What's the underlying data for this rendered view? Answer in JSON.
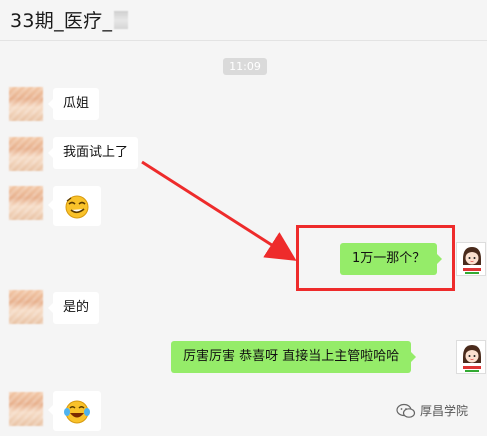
{
  "header": {
    "title": "33期_医疗_"
  },
  "timestamp": "11:09",
  "messages": {
    "m1": "瓜姐",
    "m2": "我面试上了",
    "m3": "1万一那个？",
    "m4": "是的",
    "m5": "厉害厉害   恭喜呀   直接当上主管啦哈哈"
  },
  "watermark": {
    "text": "厚昌学院"
  },
  "colors": {
    "self_bubble": "#95ec69",
    "other_bubble": "#ffffff",
    "annotation_red": "#ee2b2b"
  },
  "icons": {
    "emoji_1": "sly-grin-emoji-icon",
    "emoji_2": "laughing-crying-emoji-icon",
    "self_avatar": "cartoon-girl-avatar-icon",
    "watermark": "wechat-logo-icon"
  }
}
